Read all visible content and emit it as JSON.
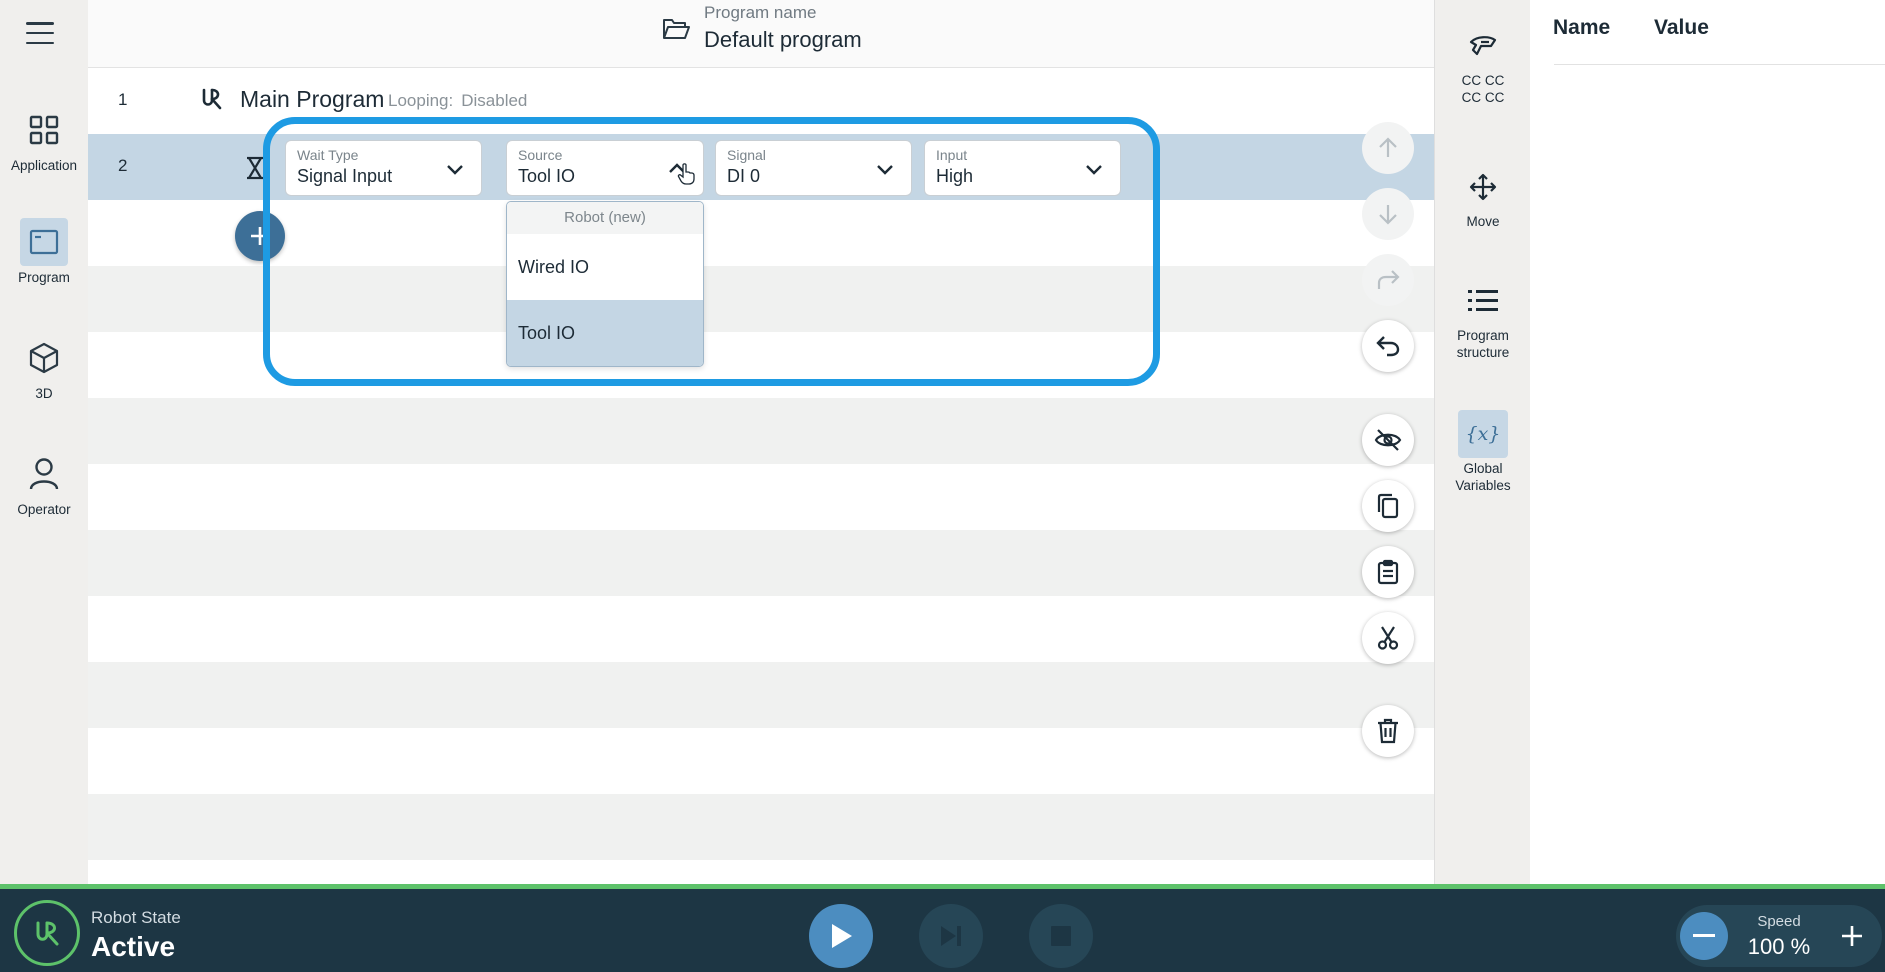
{
  "header": {
    "program_name_label": "Program name",
    "program_name": "Default program"
  },
  "nav": {
    "items": [
      {
        "label": "Application",
        "icon": "grid-icon"
      },
      {
        "label": "Program",
        "icon": "program-window-icon",
        "active": true
      },
      {
        "label": "3D",
        "icon": "cube-icon"
      },
      {
        "label": "Operator",
        "icon": "person-icon"
      }
    ]
  },
  "tree": {
    "rows": [
      {
        "number": "1",
        "title": "Main Program",
        "looping_label": "Looping:",
        "looping_value": "Disabled"
      },
      {
        "number": "2"
      }
    ]
  },
  "wait_node": {
    "wait_type": {
      "caption": "Wait Type",
      "value": "Signal Input"
    },
    "source": {
      "caption": "Source",
      "value": "Tool IO",
      "open": true
    },
    "signal": {
      "caption": "Signal",
      "value": "DI 0"
    },
    "input": {
      "caption": "Input",
      "value": "High"
    }
  },
  "source_menu": {
    "header": "Robot (new)",
    "options": [
      {
        "label": "Wired IO",
        "selected": false
      },
      {
        "label": "Tool IO",
        "selected": true
      }
    ]
  },
  "right_nav": {
    "items": [
      {
        "label_line1": "CC CC",
        "label_line2": "CC CC",
        "icon": "tool-gripper-icon"
      },
      {
        "label_line1": "Move",
        "label_line2": "",
        "icon": "move-arrows-icon"
      },
      {
        "label_line1": "Program",
        "label_line2": "structure",
        "icon": "list-icon"
      },
      {
        "label_line1": "Global",
        "label_line2": "Variables",
        "icon": "variable-x-icon",
        "active": true
      }
    ]
  },
  "variables": {
    "col_name": "Name",
    "col_value": "Value"
  },
  "footer": {
    "robot_state_label": "Robot State",
    "robot_state_value": "Active",
    "speed_label": "Speed",
    "speed_value": "100 %"
  },
  "colors": {
    "accent_blue": "#1e9be3",
    "selection": "#c4d6e4",
    "footer_bg": "#1d3644",
    "active_green": "#5dc26a",
    "play_blue": "#4c8dc0"
  }
}
